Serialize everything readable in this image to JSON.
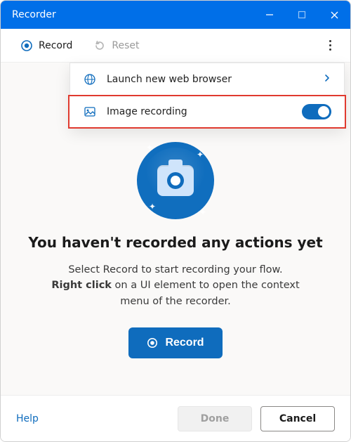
{
  "titlebar": {
    "title": "Recorder"
  },
  "toolbar": {
    "record_label": "Record",
    "reset_label": "Reset"
  },
  "menu": {
    "launch_label": "Launch new web browser",
    "image_recording_label": "Image recording",
    "image_recording_enabled": true
  },
  "hero": {
    "title": "You haven't recorded any actions yet",
    "desc_line1": "Select Record to start recording your flow.",
    "desc_bold": "Right click",
    "desc_line2_rest": " on a UI element to open the context menu of the recorder.",
    "cta_label": "Record"
  },
  "footer": {
    "help_label": "Help",
    "done_label": "Done",
    "cancel_label": "Cancel"
  },
  "colors": {
    "accent": "#0f6cbd",
    "titlebar": "#006fe8"
  }
}
